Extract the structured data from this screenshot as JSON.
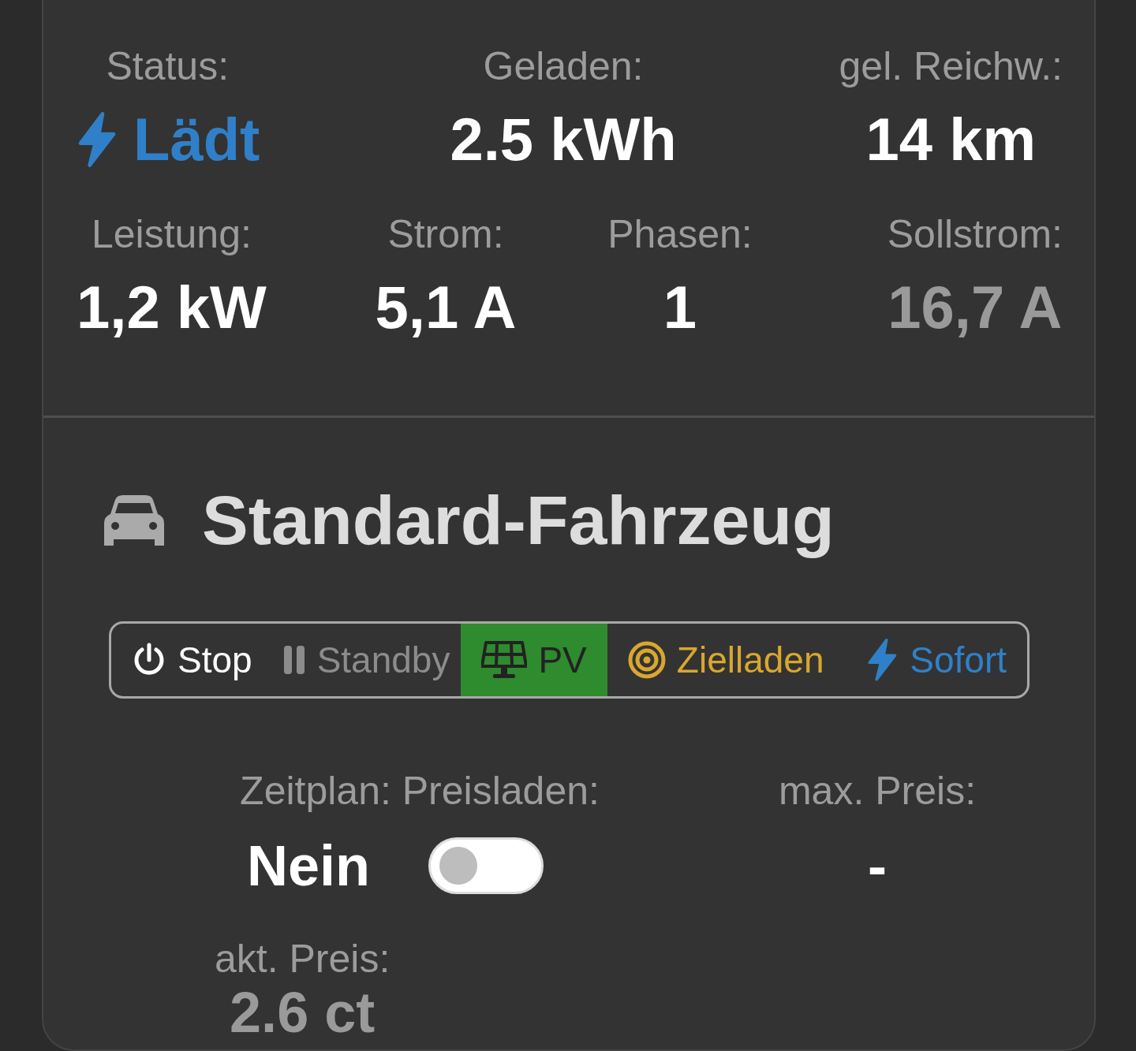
{
  "charging_stats": [
    {
      "label": "Status:",
      "value": "Lädt",
      "kind": "status"
    },
    {
      "label": "Geladen:",
      "value": "2.5 kWh",
      "kind": "value"
    },
    {
      "label": "gel. Reichw.:",
      "value": "14 km",
      "kind": "value"
    }
  ],
  "power_stats": [
    {
      "label": "Leistung:",
      "value": "1,2 kW",
      "muted": false
    },
    {
      "label": "Strom:",
      "value": "5,1 A",
      "muted": false
    },
    {
      "label": "Phasen:",
      "value": "1",
      "muted": false
    },
    {
      "label": "Sollstrom:",
      "value": "16,7 A",
      "muted": true
    }
  ],
  "vehicle": {
    "title": "Standard-Fahrzeug"
  },
  "modes": [
    {
      "label": "Stop",
      "kind": "stop",
      "color": "#ffffff",
      "selected": false
    },
    {
      "label": "Standby",
      "kind": "standby",
      "color": "#8c8c8c",
      "selected": false
    },
    {
      "label": "PV",
      "kind": "pv",
      "color": "#2e8b2e",
      "selected": true
    },
    {
      "label": "Zielladen",
      "kind": "target",
      "color": "#d9a72e",
      "selected": false
    },
    {
      "label": "Sofort",
      "kind": "instant",
      "color": "#2f80c8",
      "selected": false
    }
  ],
  "schedule": {
    "label": "Zeitplan: Preisladen:",
    "value": "Nein",
    "on": false
  },
  "max_price": {
    "label": "max. Preis:",
    "value": "-"
  },
  "current_price": {
    "label": "akt. Preis:",
    "value": "2.6 ct"
  }
}
